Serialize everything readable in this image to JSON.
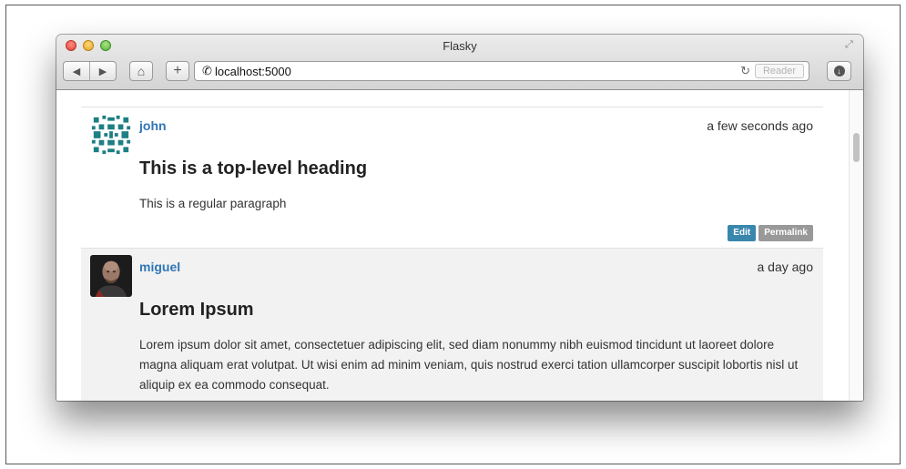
{
  "window": {
    "title": "Flasky",
    "url": "localhost:5000",
    "reader_label": "Reader",
    "back_glyph": "◀",
    "forward_glyph": "▶",
    "home_glyph": "⌂",
    "new_tab_glyph": "+",
    "phone_glyph": "✆",
    "reload_glyph": "↻",
    "resize_glyph": "⤢",
    "download_glyph": "↓"
  },
  "posts": [
    {
      "author": "john",
      "date": "a few seconds ago",
      "title": "This is a top-level heading",
      "body": "This is a regular paragraph",
      "edit_label": "Edit",
      "permalink_label": "Permalink",
      "avatar": "identicon-teal"
    },
    {
      "author": "miguel",
      "date": "a day ago",
      "title": "Lorem Ipsum",
      "body": "Lorem ipsum dolor sit amet, consectetuer adipiscing elit, sed diam nonummy nibh euismod tincidunt ut laoreet dolore magna aliquam erat volutpat. Ut wisi enim ad minim veniam, quis nostrud exerci tation ullamcorper suscipit lobortis nisl ut aliquip ex ea commodo consequat.",
      "avatar": "photo-portrait"
    }
  ],
  "colors": {
    "link": "#2f76b5",
    "edit_badge": "#3a87ad",
    "permalink_badge": "#999999",
    "identicon": "#1e7f84",
    "alt_row": "#f2f2f2"
  }
}
